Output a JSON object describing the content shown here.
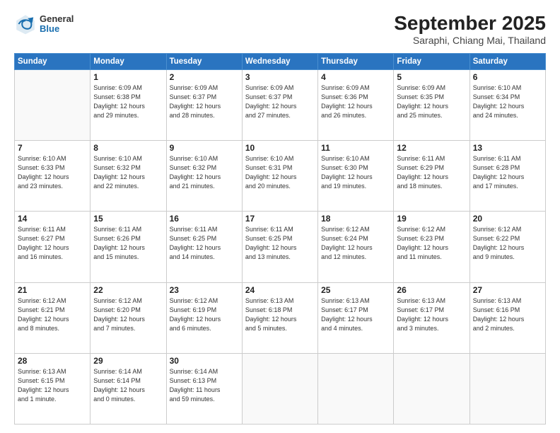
{
  "header": {
    "logo": {
      "general": "General",
      "blue": "Blue"
    },
    "title": "September 2025",
    "subtitle": "Saraphi, Chiang Mai, Thailand"
  },
  "weekdays": [
    "Sunday",
    "Monday",
    "Tuesday",
    "Wednesday",
    "Thursday",
    "Friday",
    "Saturday"
  ],
  "weeks": [
    [
      {
        "day": "",
        "info": ""
      },
      {
        "day": "1",
        "info": "Sunrise: 6:09 AM\nSunset: 6:38 PM\nDaylight: 12 hours\nand 29 minutes."
      },
      {
        "day": "2",
        "info": "Sunrise: 6:09 AM\nSunset: 6:37 PM\nDaylight: 12 hours\nand 28 minutes."
      },
      {
        "day": "3",
        "info": "Sunrise: 6:09 AM\nSunset: 6:37 PM\nDaylight: 12 hours\nand 27 minutes."
      },
      {
        "day": "4",
        "info": "Sunrise: 6:09 AM\nSunset: 6:36 PM\nDaylight: 12 hours\nand 26 minutes."
      },
      {
        "day": "5",
        "info": "Sunrise: 6:09 AM\nSunset: 6:35 PM\nDaylight: 12 hours\nand 25 minutes."
      },
      {
        "day": "6",
        "info": "Sunrise: 6:10 AM\nSunset: 6:34 PM\nDaylight: 12 hours\nand 24 minutes."
      }
    ],
    [
      {
        "day": "7",
        "info": "Sunrise: 6:10 AM\nSunset: 6:33 PM\nDaylight: 12 hours\nand 23 minutes."
      },
      {
        "day": "8",
        "info": "Sunrise: 6:10 AM\nSunset: 6:32 PM\nDaylight: 12 hours\nand 22 minutes."
      },
      {
        "day": "9",
        "info": "Sunrise: 6:10 AM\nSunset: 6:32 PM\nDaylight: 12 hours\nand 21 minutes."
      },
      {
        "day": "10",
        "info": "Sunrise: 6:10 AM\nSunset: 6:31 PM\nDaylight: 12 hours\nand 20 minutes."
      },
      {
        "day": "11",
        "info": "Sunrise: 6:10 AM\nSunset: 6:30 PM\nDaylight: 12 hours\nand 19 minutes."
      },
      {
        "day": "12",
        "info": "Sunrise: 6:11 AM\nSunset: 6:29 PM\nDaylight: 12 hours\nand 18 minutes."
      },
      {
        "day": "13",
        "info": "Sunrise: 6:11 AM\nSunset: 6:28 PM\nDaylight: 12 hours\nand 17 minutes."
      }
    ],
    [
      {
        "day": "14",
        "info": "Sunrise: 6:11 AM\nSunset: 6:27 PM\nDaylight: 12 hours\nand 16 minutes."
      },
      {
        "day": "15",
        "info": "Sunrise: 6:11 AM\nSunset: 6:26 PM\nDaylight: 12 hours\nand 15 minutes."
      },
      {
        "day": "16",
        "info": "Sunrise: 6:11 AM\nSunset: 6:25 PM\nDaylight: 12 hours\nand 14 minutes."
      },
      {
        "day": "17",
        "info": "Sunrise: 6:11 AM\nSunset: 6:25 PM\nDaylight: 12 hours\nand 13 minutes."
      },
      {
        "day": "18",
        "info": "Sunrise: 6:12 AM\nSunset: 6:24 PM\nDaylight: 12 hours\nand 12 minutes."
      },
      {
        "day": "19",
        "info": "Sunrise: 6:12 AM\nSunset: 6:23 PM\nDaylight: 12 hours\nand 11 minutes."
      },
      {
        "day": "20",
        "info": "Sunrise: 6:12 AM\nSunset: 6:22 PM\nDaylight: 12 hours\nand 9 minutes."
      }
    ],
    [
      {
        "day": "21",
        "info": "Sunrise: 6:12 AM\nSunset: 6:21 PM\nDaylight: 12 hours\nand 8 minutes."
      },
      {
        "day": "22",
        "info": "Sunrise: 6:12 AM\nSunset: 6:20 PM\nDaylight: 12 hours\nand 7 minutes."
      },
      {
        "day": "23",
        "info": "Sunrise: 6:12 AM\nSunset: 6:19 PM\nDaylight: 12 hours\nand 6 minutes."
      },
      {
        "day": "24",
        "info": "Sunrise: 6:13 AM\nSunset: 6:18 PM\nDaylight: 12 hours\nand 5 minutes."
      },
      {
        "day": "25",
        "info": "Sunrise: 6:13 AM\nSunset: 6:17 PM\nDaylight: 12 hours\nand 4 minutes."
      },
      {
        "day": "26",
        "info": "Sunrise: 6:13 AM\nSunset: 6:17 PM\nDaylight: 12 hours\nand 3 minutes."
      },
      {
        "day": "27",
        "info": "Sunrise: 6:13 AM\nSunset: 6:16 PM\nDaylight: 12 hours\nand 2 minutes."
      }
    ],
    [
      {
        "day": "28",
        "info": "Sunrise: 6:13 AM\nSunset: 6:15 PM\nDaylight: 12 hours\nand 1 minute."
      },
      {
        "day": "29",
        "info": "Sunrise: 6:14 AM\nSunset: 6:14 PM\nDaylight: 12 hours\nand 0 minutes."
      },
      {
        "day": "30",
        "info": "Sunrise: 6:14 AM\nSunset: 6:13 PM\nDaylight: 11 hours\nand 59 minutes."
      },
      {
        "day": "",
        "info": ""
      },
      {
        "day": "",
        "info": ""
      },
      {
        "day": "",
        "info": ""
      },
      {
        "day": "",
        "info": ""
      }
    ]
  ]
}
